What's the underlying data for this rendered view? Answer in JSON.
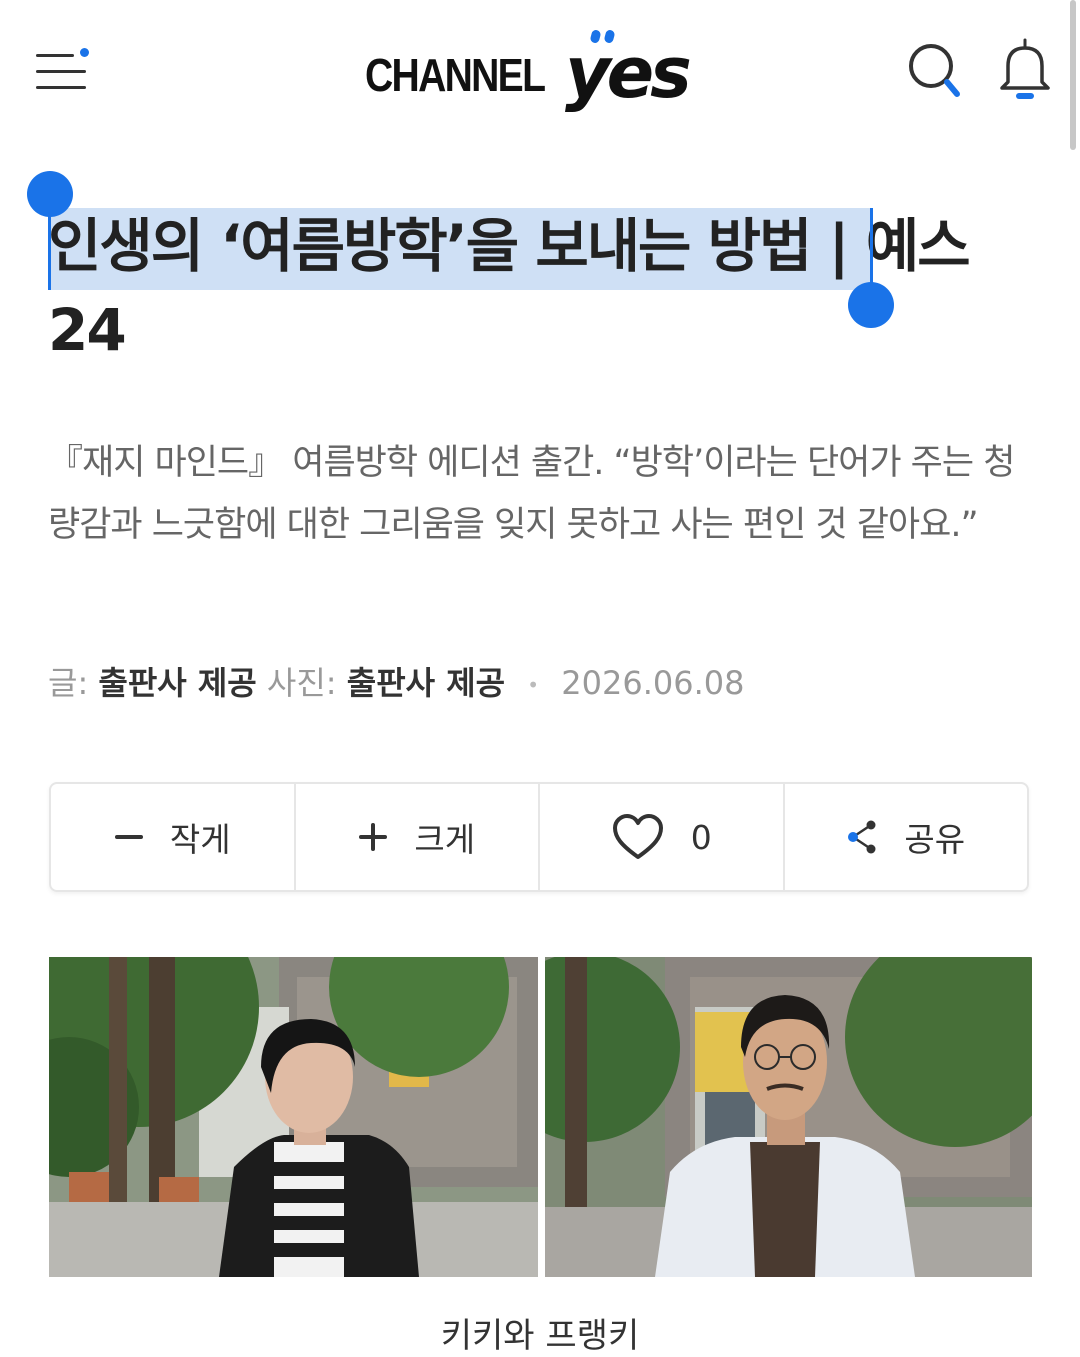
{
  "header": {
    "logo": {
      "word": "CHANNEL",
      "brand": "yes"
    },
    "menu_icon": "menu-icon",
    "search_icon": "search-icon",
    "bell_icon": "bell-icon"
  },
  "article": {
    "title_selected": "인생의 ‘여름방학’을 보내는 방법",
    "title_rest": " | 예스24",
    "subtitle": "『재지 마인드』 여름방학 에디션 출간. “방학’이라는 단어가 주는 청량감과 느긋함에 대한 그리움을 잊지 못하고 사는 편인 것 같아요.”",
    "byline": {
      "writer_label": "글:",
      "writer": "출판사 제공",
      "photo_label": "사진:",
      "photographer": "출판사 제공",
      "separator": "•",
      "date": "2026.06.08"
    },
    "toolbar": {
      "smaller_label": "작게",
      "larger_label": "크게",
      "like_count": "0",
      "share_label": "공유"
    },
    "photo_caption": "키키와 프랭키"
  },
  "colors": {
    "accent": "#1a73e8",
    "selection": "#cfe0f5",
    "title": "#222222",
    "subtitle": "#666666"
  }
}
